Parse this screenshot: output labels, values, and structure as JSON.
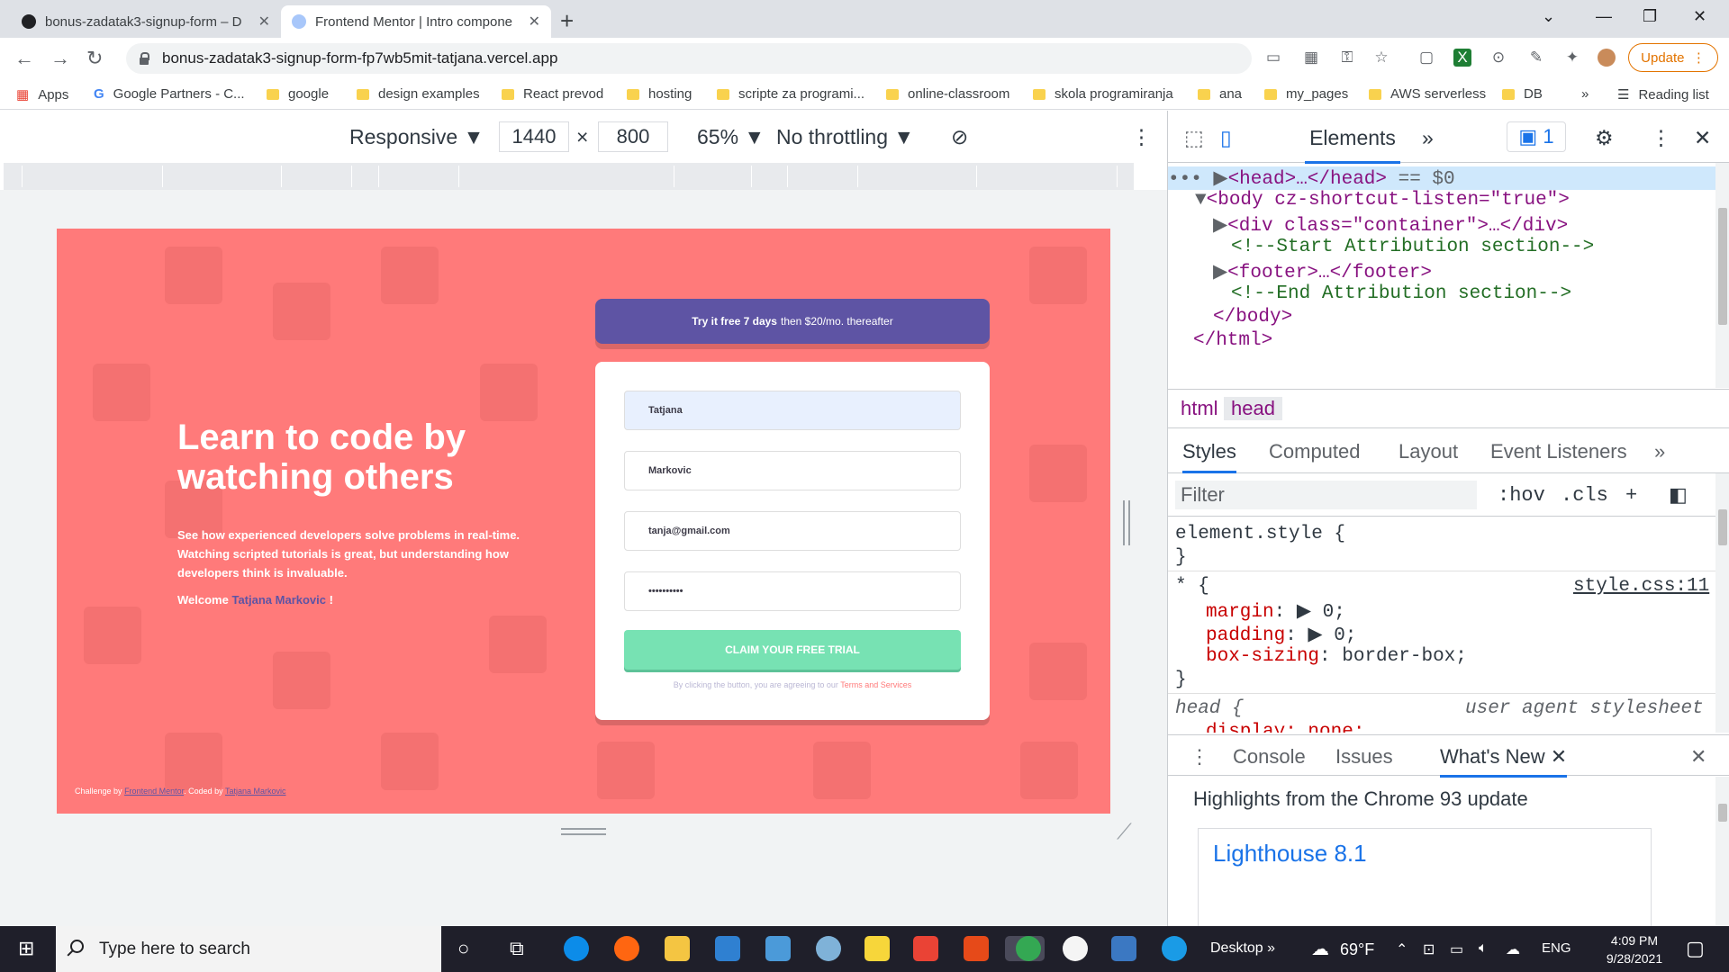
{
  "browser": {
    "tabs": [
      {
        "title": "bonus-zadatak3-signup-form – D",
        "active": false
      },
      {
        "title": "Frontend Mentor | Intro compone",
        "active": true
      }
    ],
    "address": "bonus-zadatak3-signup-form-fp7wb5mit-tatjana.vercel.app",
    "update_label": "Update",
    "bookmarks": [
      "Apps",
      "Google Partners - C...",
      "google",
      "design examples",
      "React prevod",
      "hosting",
      "scripte za programi...",
      "online-classroom",
      "skola programiranja",
      "ana",
      "my_pages",
      "AWS serverless",
      "DB"
    ],
    "more_bookmarks": "»",
    "reading_list": "Reading list"
  },
  "device_toolbar": {
    "device": "Responsive",
    "width": "1440",
    "times": "×",
    "height": "800",
    "zoom": "65%",
    "throttling": "No throttling"
  },
  "page": {
    "headline": "Learn to code by watching others",
    "description": "See how experienced developers solve problems in real-time. Watching scripted tutorials is great, but understanding how developers think is invaluable.",
    "welcome_prefix": "Welcome",
    "welcome_name": "Tatjana Markovic",
    "welcome_suffix": "!",
    "promo_bold": "Try it free 7 days",
    "promo_rest": "then $20/mo. thereafter",
    "form": {
      "first_name": "Tatjana",
      "last_name": "Markovic",
      "email": "tanja@gmail.com",
      "password": "••••••••••",
      "submit": "CLAIM YOUR FREE TRIAL",
      "terms_text": "By clicking the button, you are agreeing to our",
      "terms_link": "Terms and Services"
    },
    "attribution": {
      "challenge_by": "Challenge by",
      "fm_link": "Frontend Mentor",
      "coded_by": ". Coded by",
      "author_link": "Tatjana Markovic"
    },
    "colors": {
      "background": "#ff7a7a",
      "accent": "#5e54a4",
      "button": "#77e2b3"
    }
  },
  "devtools": {
    "tabs": [
      "Elements",
      "»"
    ],
    "issues_count": "1",
    "dom": [
      {
        "prefix": "•••",
        "text": "<head>…</head>",
        "suffix": "== $0"
      },
      {
        "text": "<body cz-shortcut-listen=\"true\">"
      },
      {
        "text": "<div class=\"container\">…</div>"
      },
      {
        "text": "<!--Start Attribution section-->"
      },
      {
        "text": "<footer>…</footer>"
      },
      {
        "text": "<!--End Attribution section-->"
      },
      {
        "text": "</body>"
      },
      {
        "text": "</html>"
      }
    ],
    "breadcrumbs": [
      "html",
      "head"
    ],
    "style_tabs": [
      "Styles",
      "Computed",
      "Layout",
      "Event Listeners",
      "»"
    ],
    "filter_placeholder": "Filter",
    "filter_tools": [
      ":hov",
      ".cls",
      "+"
    ],
    "rules": {
      "element_style": "element.style {",
      "close_brace": "}",
      "universal_selector": "* {",
      "universal_source": "style.css:11",
      "props": [
        {
          "name": "margin",
          "value": "0;"
        },
        {
          "name": "padding",
          "value": "0;"
        },
        {
          "name": "box-sizing",
          "value": "border-box;"
        }
      ],
      "head_selector": "head {",
      "head_source": "user agent stylesheet",
      "head_partial": "display: none;"
    },
    "drawer_tabs": [
      "Console",
      "Issues",
      "What's New"
    ],
    "highlights": "Highlights from the Chrome 93 update",
    "lighthouse": "Lighthouse 8.1"
  },
  "taskbar": {
    "search_placeholder": "Type here to search",
    "desktop_label": "Desktop",
    "temperature": "69°F",
    "language": "ENG",
    "time": "4:09 PM",
    "date": "9/28/2021"
  }
}
